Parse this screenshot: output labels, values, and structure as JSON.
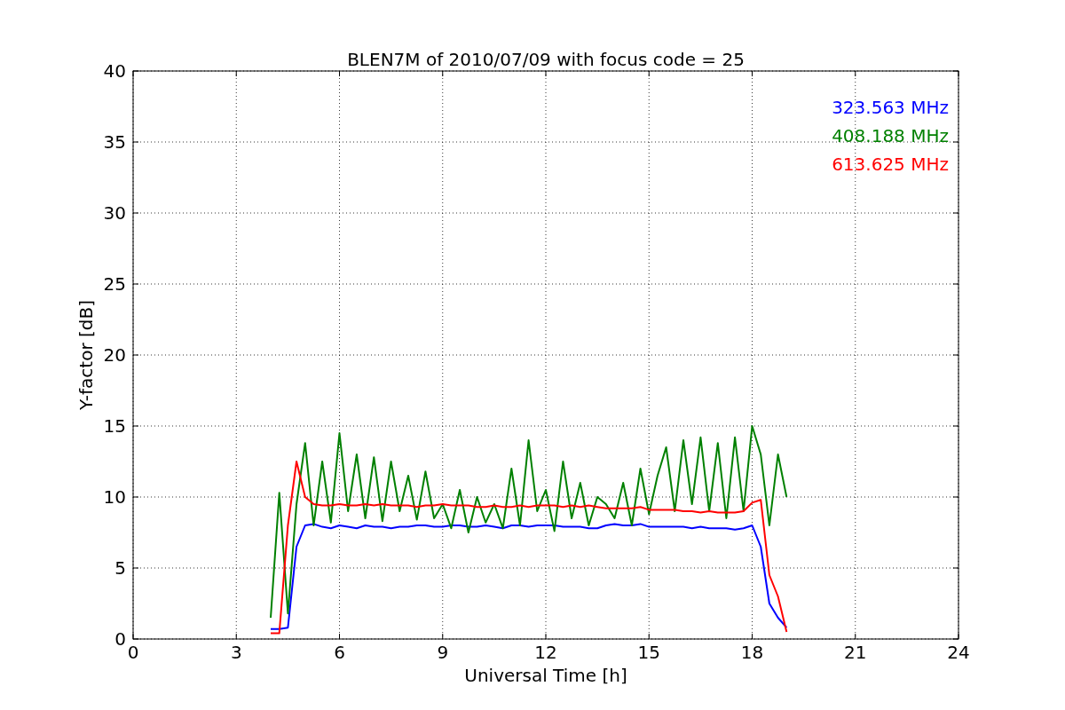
{
  "figure": {
    "chart_data": {
      "type": "line",
      "title": "BLEN7M of 2010/07/09 with focus code = 25",
      "xlabel": "Universal Time [h]",
      "ylabel": "Y-factor [dB]",
      "grid": true,
      "xlim": [
        0,
        24
      ],
      "ylim": [
        0,
        40
      ],
      "xticks": [
        0,
        3,
        6,
        9,
        12,
        15,
        18,
        21,
        24
      ],
      "yticks": [
        0,
        5,
        10,
        15,
        20,
        25,
        30,
        35,
        40
      ],
      "x": [
        4,
        4.25,
        4.5,
        4.75,
        5,
        5.25,
        5.5,
        5.75,
        6,
        6.25,
        6.5,
        6.75,
        7,
        7.25,
        7.5,
        7.75,
        8,
        8.25,
        8.5,
        8.75,
        9,
        9.25,
        9.5,
        9.75,
        10,
        10.25,
        10.5,
        10.75,
        11,
        11.25,
        11.5,
        11.75,
        12,
        12.25,
        12.5,
        12.75,
        13,
        13.25,
        13.5,
        13.75,
        14,
        14.25,
        14.5,
        14.75,
        15,
        15.25,
        15.5,
        15.75,
        16,
        16.25,
        16.5,
        16.75,
        17,
        17.25,
        17.5,
        17.75,
        18,
        18.25,
        18.5,
        18.75,
        19
      ],
      "series": [
        {
          "name": "323.563 MHz",
          "color": "#0000ff",
          "values": [
            0.7,
            0.7,
            0.8,
            6.5,
            8.0,
            8.1,
            7.9,
            7.8,
            8.0,
            7.9,
            7.8,
            8.0,
            7.9,
            7.9,
            7.8,
            7.9,
            7.9,
            8.0,
            8.0,
            7.9,
            7.9,
            8.0,
            8.0,
            7.9,
            7.9,
            8.0,
            7.9,
            7.8,
            8.0,
            8.0,
            7.9,
            8.0,
            8.0,
            8.0,
            7.9,
            7.9,
            7.9,
            7.8,
            7.8,
            8.0,
            8.1,
            8.0,
            8.0,
            8.1,
            7.9,
            7.9,
            7.9,
            7.9,
            7.9,
            7.8,
            7.9,
            7.8,
            7.8,
            7.8,
            7.7,
            7.8,
            8.0,
            6.5,
            2.5,
            1.5,
            0.8
          ]
        },
        {
          "name": "408.188 MHz",
          "color": "#008000",
          "values": [
            1.5,
            10.3,
            1.8,
            9.5,
            13.8,
            8.0,
            12.5,
            8.2,
            14.5,
            9.0,
            13.0,
            8.5,
            12.8,
            8.3,
            12.5,
            9.0,
            11.5,
            8.4,
            11.8,
            8.5,
            9.5,
            7.8,
            10.5,
            7.5,
            10.0,
            8.2,
            9.5,
            7.8,
            12.0,
            8.0,
            14.0,
            9.0,
            10.5,
            7.6,
            12.5,
            8.5,
            11.0,
            8.0,
            10.0,
            9.5,
            8.5,
            11.0,
            8.0,
            12.0,
            8.8,
            11.5,
            13.5,
            9.0,
            14.0,
            9.5,
            14.2,
            9.0,
            13.8,
            8.5,
            14.2,
            9.0,
            15.0,
            13.0,
            8.0,
            13.0,
            10.0
          ]
        },
        {
          "name": "613.625 MHz",
          "color": "#ff0000",
          "values": [
            0.4,
            0.4,
            8.0,
            12.5,
            10.0,
            9.5,
            9.4,
            9.4,
            9.5,
            9.4,
            9.4,
            9.5,
            9.4,
            9.5,
            9.4,
            9.4,
            9.4,
            9.3,
            9.4,
            9.4,
            9.5,
            9.4,
            9.4,
            9.4,
            9.3,
            9.3,
            9.4,
            9.3,
            9.3,
            9.4,
            9.3,
            9.4,
            9.4,
            9.4,
            9.3,
            9.4,
            9.3,
            9.4,
            9.3,
            9.2,
            9.2,
            9.2,
            9.2,
            9.3,
            9.1,
            9.1,
            9.1,
            9.1,
            9.0,
            9.0,
            8.9,
            9.0,
            8.9,
            8.9,
            8.9,
            9.0,
            9.6,
            9.8,
            4.5,
            3.0,
            0.5
          ]
        }
      ]
    }
  }
}
